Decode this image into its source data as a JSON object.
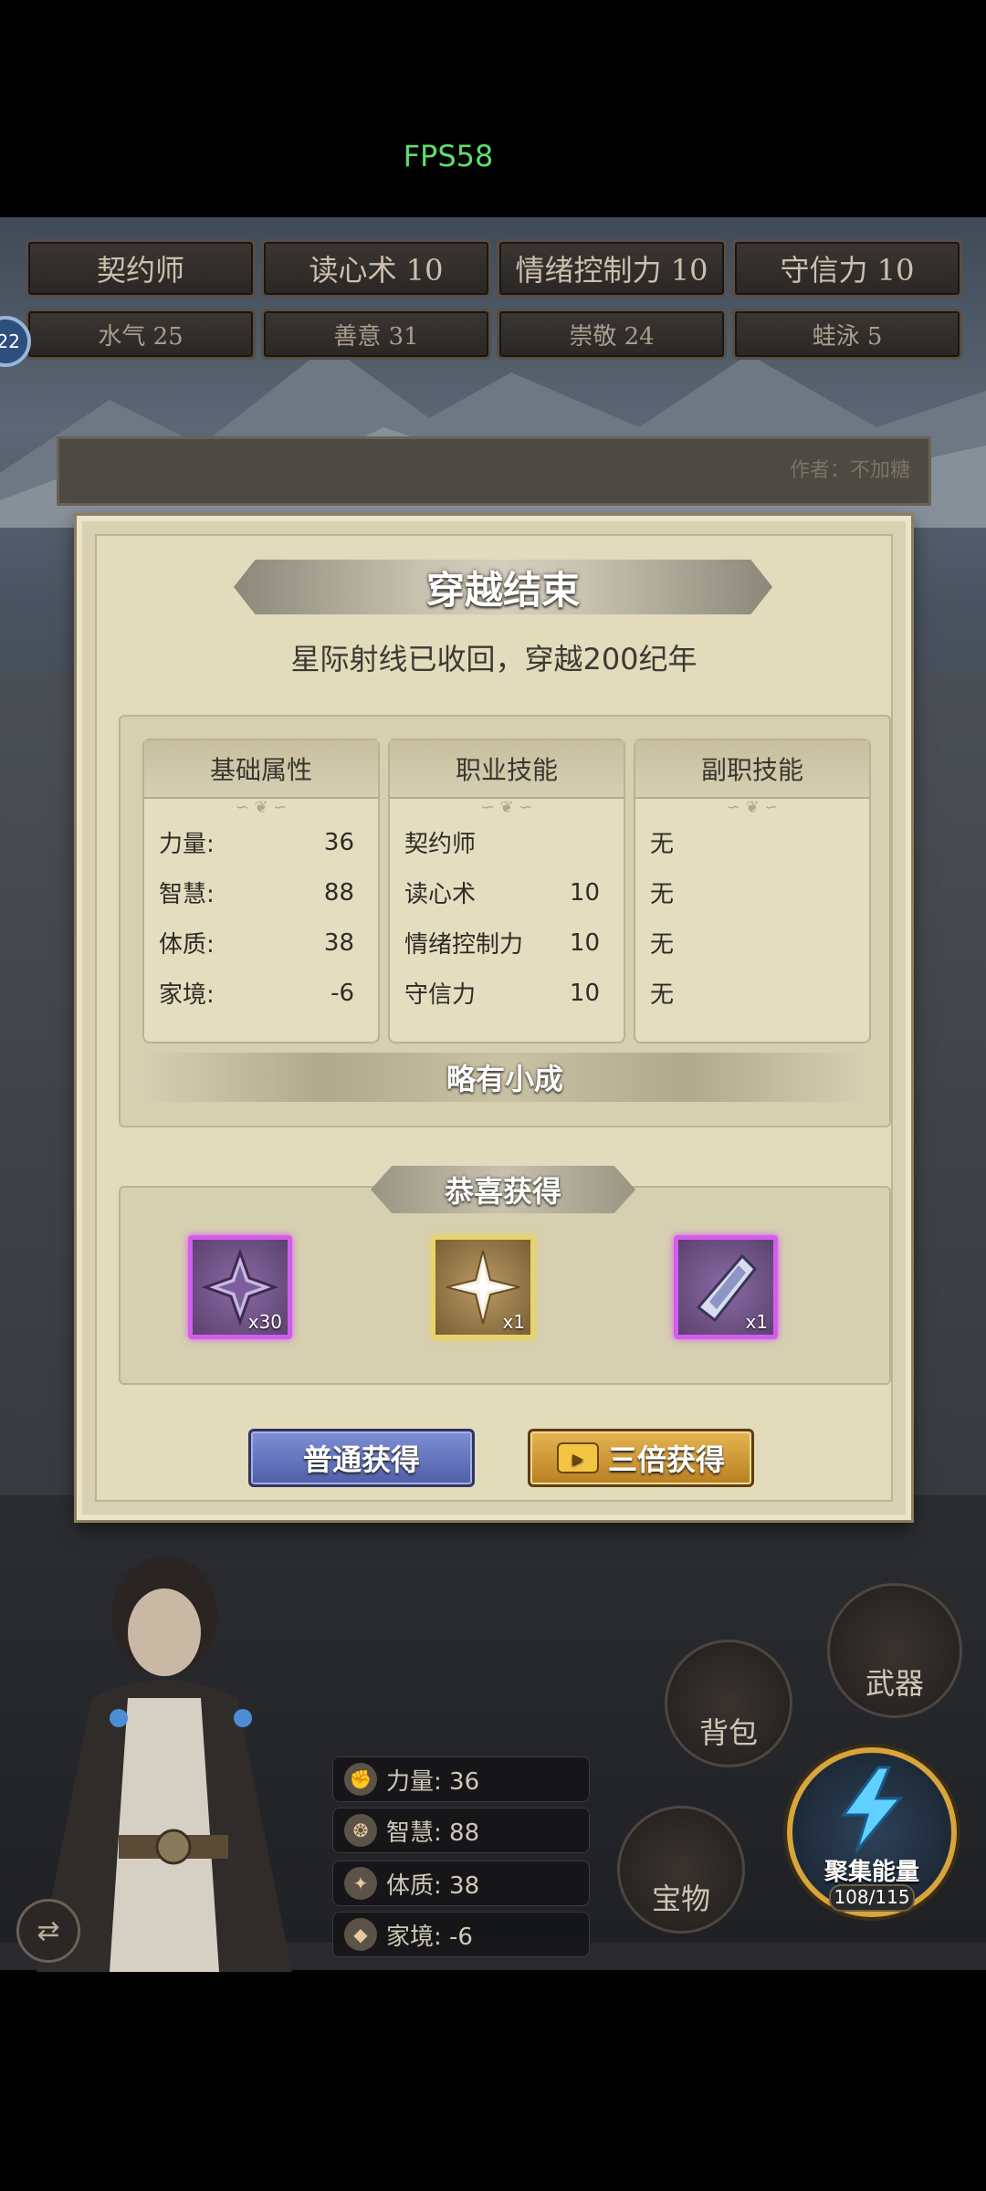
{
  "status": {
    "fps": "FPS58"
  },
  "top_chips": {
    "row1": [
      "契约师",
      "读心术 10",
      "情绪控制力 10",
      "守信力 10"
    ],
    "row2": [
      "水气 25",
      "善意 31",
      "崇敬 24",
      "蛙泳 5"
    ],
    "level_badge": "22"
  },
  "background_panel": {
    "author": "作者：不加糖"
  },
  "dialog": {
    "title": "穿越结束",
    "subtitle": "星际射线已收回，穿越200纪年",
    "columns": [
      {
        "header": "基础属性",
        "rows": [
          {
            "label": "力量:",
            "value": "36"
          },
          {
            "label": "智慧:",
            "value": "88"
          },
          {
            "label": "体质:",
            "value": "38"
          },
          {
            "label": "家境:",
            "value": "-6"
          }
        ]
      },
      {
        "header": "职业技能",
        "rows": [
          {
            "label": "契约师",
            "value": ""
          },
          {
            "label": "读心术",
            "value": "10"
          },
          {
            "label": "情绪控制力",
            "value": "10"
          },
          {
            "label": "守信力",
            "value": "10"
          }
        ]
      },
      {
        "header": "副职技能",
        "rows": [
          {
            "label": "无",
            "value": ""
          },
          {
            "label": "无",
            "value": ""
          },
          {
            "label": "无",
            "value": ""
          },
          {
            "label": "无",
            "value": ""
          }
        ]
      }
    ],
    "rating": "略有小成",
    "reward_title": "恭喜获得",
    "rewards": [
      {
        "icon": "purple-star-icon",
        "qty": "x30",
        "rarity": "purple"
      },
      {
        "icon": "gold-star-icon",
        "qty": "x1",
        "rarity": "gold"
      },
      {
        "icon": "crystal-icon",
        "qty": "x1",
        "rarity": "purple"
      }
    ],
    "buttons": {
      "normal": "普通获得",
      "triple": "三倍获得"
    }
  },
  "hud": {
    "stats": [
      {
        "icon": "fist-icon",
        "text": "力量: 36"
      },
      {
        "icon": "brain-icon",
        "text": "智慧: 88"
      },
      {
        "icon": "arm-icon",
        "text": "体质: 38"
      },
      {
        "icon": "diamond-icon",
        "text": "家境: -6"
      }
    ],
    "menu": {
      "weapon": "武器",
      "bag": "背包",
      "treasure": "宝物"
    },
    "energy": {
      "label": "聚集能量",
      "count": "108/115"
    }
  },
  "colors": {
    "purple_rarity": "#d55cf0",
    "gold_rarity": "#e9d36c",
    "fps_green": "#5fdc6f"
  }
}
